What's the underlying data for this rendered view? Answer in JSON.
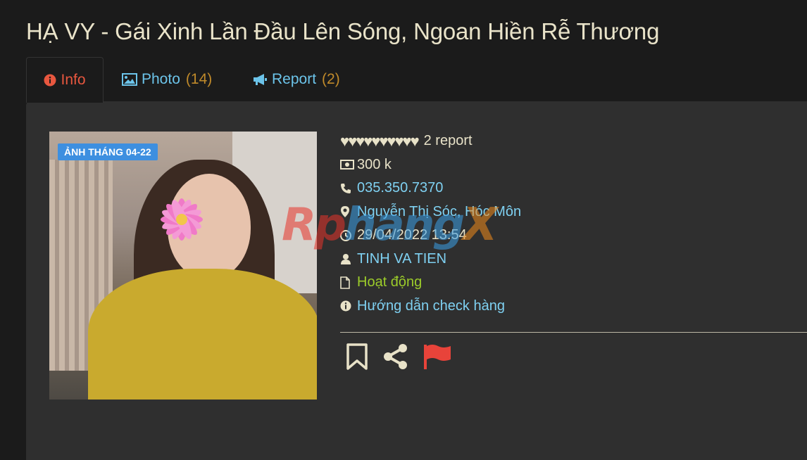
{
  "page": {
    "title": "HẠ VY - Gái Xinh Lần Đầu Lên Sóng, Ngoan Hiền Rễ Thương"
  },
  "tabs": [
    {
      "label": "Info",
      "count": "",
      "icon": "info-circle-icon"
    },
    {
      "label": "Photo",
      "count": "(14)",
      "icon": "image-icon"
    },
    {
      "label": "Report",
      "count": "(2)",
      "icon": "bullhorn-icon"
    }
  ],
  "photo": {
    "badge": "ẢNH THÁNG 04-22"
  },
  "info": {
    "hearts": "♥♥♥♥♥♥♥♥♥♥",
    "rating_fraction": 1.0,
    "report_count": "2 report",
    "price": "300 k",
    "phone": "035.350.7370",
    "location": "Nguyễn Thị Sóc, Hóc Môn",
    "datetime": "29/04/2022 13:54",
    "user": "TINH VA TIEN",
    "status": "Hoạt động",
    "guide": "Hướng dẫn check hàng"
  },
  "watermark": {
    "part1": "Rp",
    "part2": "hang",
    "part3": "X"
  },
  "colors": {
    "background": "#1b1b1b",
    "panel": "#2f2f2f",
    "active_tab": "#e8573f",
    "link": "#6cc4ea",
    "count": "#c08a2a",
    "status_green": "#9ccc2a",
    "badge": "#3d8fe0",
    "flag": "#e8433a"
  }
}
